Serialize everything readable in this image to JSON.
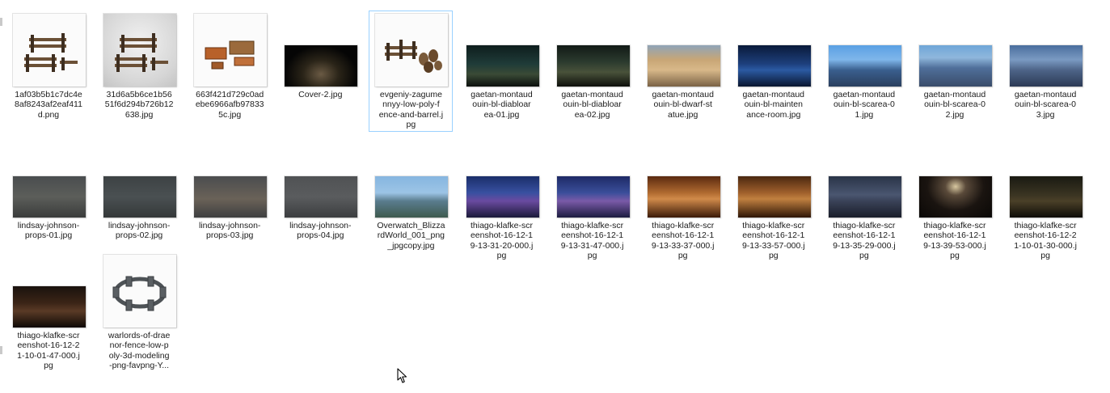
{
  "files": [
    {
      "name": "1af03b5b1c7dc4e8af8243af2eaf411d.png",
      "label": "1af03b5b1c7dc4e\n8af8243af2eaf411\nd.png",
      "thumb": "props-white",
      "selected": false
    },
    {
      "name": "31d6a5b6ce1b5651f6d294b726b12638.jpg",
      "label": "31d6a5b6ce1b56\n51f6d294b726b12\n638.jpg",
      "thumb": "props-grey",
      "selected": false
    },
    {
      "name": "663f421d729c0adebe6966afb978335c.jpg",
      "label": "663f421d729c0ad\nebe6966afb97833\n5c.jpg",
      "thumb": "furniture-white",
      "selected": false
    },
    {
      "name": "Cover-2.jpg",
      "label": "Cover-2.jpg",
      "thumb": "dark-scene",
      "selected": false
    },
    {
      "name": "evgeniy-zagumennyy-low-poly-fence-and-barrel.jpg",
      "label": "evgeniy-zagume\nnnyy-low-poly-f\nence-and-barrel.j\npg",
      "thumb": "fence-barrel",
      "selected": true
    },
    {
      "name": "gaetan-montaudouin-bl-diabloarea-01.jpg",
      "label": "gaetan-montaud\nouin-bl-diabloar\nea-01.jpg",
      "thumb": "teal-dark",
      "selected": false
    },
    {
      "name": "gaetan-montaudouin-bl-diabloarea-02.jpg",
      "label": "gaetan-montaud\nouin-bl-diabloar\nea-02.jpg",
      "thumb": "teal-dark2",
      "selected": false
    },
    {
      "name": "gaetan-montaudouin-bl-dwarf-statue.jpg",
      "label": "gaetan-montaud\nouin-bl-dwarf-st\natue.jpg",
      "thumb": "warm-hall",
      "selected": false
    },
    {
      "name": "gaetan-montaudouin-bl-maintenance-room.jpg",
      "label": "gaetan-montaud\nouin-bl-mainten\nance-room.jpg",
      "thumb": "blue-room",
      "selected": false
    },
    {
      "name": "gaetan-montaudouin-bl-scarea-01.jpg",
      "label": "gaetan-montaud\nouin-bl-scarea-0\n1.jpg",
      "thumb": "blue-sky",
      "selected": false
    },
    {
      "name": "gaetan-montaudouin-bl-scarea-02.jpg",
      "label": "gaetan-montaud\nouin-bl-scarea-0\n2.jpg",
      "thumb": "blue-sky2",
      "selected": false
    },
    {
      "name": "gaetan-montaudouin-bl-scarea-03.jpg",
      "label": "gaetan-montaud\nouin-bl-scarea-0\n3.jpg",
      "thumb": "blue-sky3",
      "selected": false
    },
    {
      "name": "lindsay-johnson-props-01.jpg",
      "label": "lindsay-johnson-\nprops-01.jpg",
      "thumb": "props-dark1",
      "selected": false
    },
    {
      "name": "lindsay-johnson-props-02.jpg",
      "label": "lindsay-johnson-\nprops-02.jpg",
      "thumb": "props-dark2",
      "selected": false
    },
    {
      "name": "lindsay-johnson-props-03.jpg",
      "label": "lindsay-johnson-\nprops-03.jpg",
      "thumb": "props-dark3",
      "selected": false
    },
    {
      "name": "lindsay-johnson-props-04.jpg",
      "label": "lindsay-johnson-\nprops-04.jpg",
      "thumb": "props-dark4",
      "selected": false
    },
    {
      "name": "Overwatch_BlizzardWorld_001_png_jpgcopy.jpg",
      "label": "Overwatch_Blizza\nrdWorld_001_png\n_jpgcopy.jpg",
      "thumb": "castle-sky",
      "selected": false
    },
    {
      "name": "thiago-klafke-screenshot-16-12-19-13-31-20-000.jpg",
      "label": "thiago-klafke-scr\neenshot-16-12-1\n9-13-31-20-000.j\npg",
      "thumb": "night-blue",
      "selected": false
    },
    {
      "name": "thiago-klafke-screenshot-16-12-19-13-31-47-000.jpg",
      "label": "thiago-klafke-scr\neenshot-16-12-1\n9-13-31-47-000.j\npg",
      "thumb": "night-blue2",
      "selected": false
    },
    {
      "name": "thiago-klafke-screenshot-16-12-19-13-33-37-000.jpg",
      "label": "thiago-klafke-scr\neenshot-16-12-1\n9-13-33-37-000.j\npg",
      "thumb": "amber-hall",
      "selected": false
    },
    {
      "name": "thiago-klafke-screenshot-16-12-19-13-33-57-000.jpg",
      "label": "thiago-klafke-scr\neenshot-16-12-1\n9-13-33-57-000.j\npg",
      "thumb": "amber-hall2",
      "selected": false
    },
    {
      "name": "thiago-klafke-screenshot-16-12-19-13-35-29-000.jpg",
      "label": "thiago-klafke-scr\neenshot-16-12-1\n9-13-35-29-000.j\npg",
      "thumb": "slate-room",
      "selected": false
    },
    {
      "name": "thiago-klafke-screenshot-16-12-19-13-39-53-000.jpg",
      "label": "thiago-klafke-scr\neenshot-16-12-1\n9-13-39-53-000.j\npg",
      "thumb": "dark-lamp",
      "selected": false
    },
    {
      "name": "thiago-klafke-screenshot-16-12-21-10-01-30-000.jpg",
      "label": "thiago-klafke-scr\neenshot-16-12-2\n1-10-01-30-000.j\npg",
      "thumb": "dark-olive",
      "selected": false
    },
    {
      "name": "thiago-klafke-screenshot-16-12-21-10-01-47-000.jpg",
      "label": "thiago-klafke-scr\neenshot-16-12-2\n1-10-01-47-000.j\npg",
      "thumb": "dark-brown",
      "selected": false
    },
    {
      "name": "warlords-of-draenor-fence-low-poly-3d-modeling-png-favpng-Y...",
      "label": "warlords-of-drae\nnor-fence-low-p\noly-3d-modeling\n-png-favpng-Y...",
      "thumb": "fence-ring",
      "selected": false
    }
  ],
  "colors": {
    "selection_border": "#99d1ff",
    "label_text": "#1b1b1b",
    "background": "#ffffff"
  },
  "cursor": "arrow-pointer-icon"
}
